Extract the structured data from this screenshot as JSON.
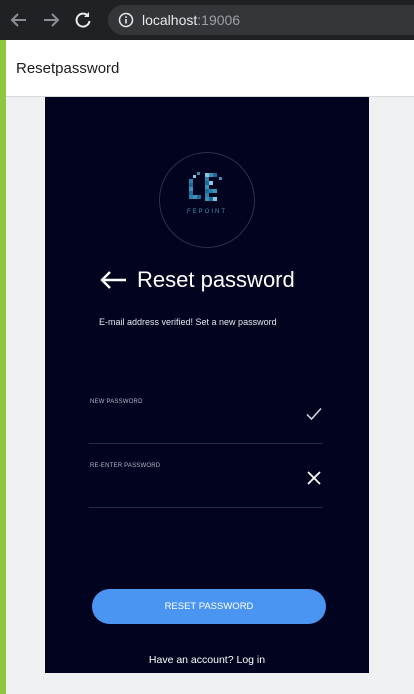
{
  "browser": {
    "url_host": "localhost",
    "url_port": ":19006",
    "icons": [
      "back-arrow-icon",
      "forward-arrow-icon",
      "reload-icon",
      "info-icon"
    ]
  },
  "page": {
    "title": "Resetpassword"
  },
  "logo": {
    "text": "FEPOINT",
    "colors": [
      "#1a6d9a",
      "#3f90b5",
      "#8ac6e0"
    ]
  },
  "heading": "Reset password",
  "subtitle": "E-mail address verified! Set a new password",
  "fields": {
    "new_password": {
      "label": "NEW PASSWORD",
      "value": "",
      "status": "check-icon"
    },
    "reenter_password": {
      "label": "RE-ENTER PASSWORD",
      "value": "",
      "status": "close-icon"
    }
  },
  "button": {
    "label": "RESET PASSWORD"
  },
  "footer": {
    "prompt": "Have an account?",
    "link": "Log in"
  },
  "colors": {
    "panel_bg": "#02031e",
    "accent_button": "#4b95f2",
    "side_accent": "#8dc63f"
  }
}
